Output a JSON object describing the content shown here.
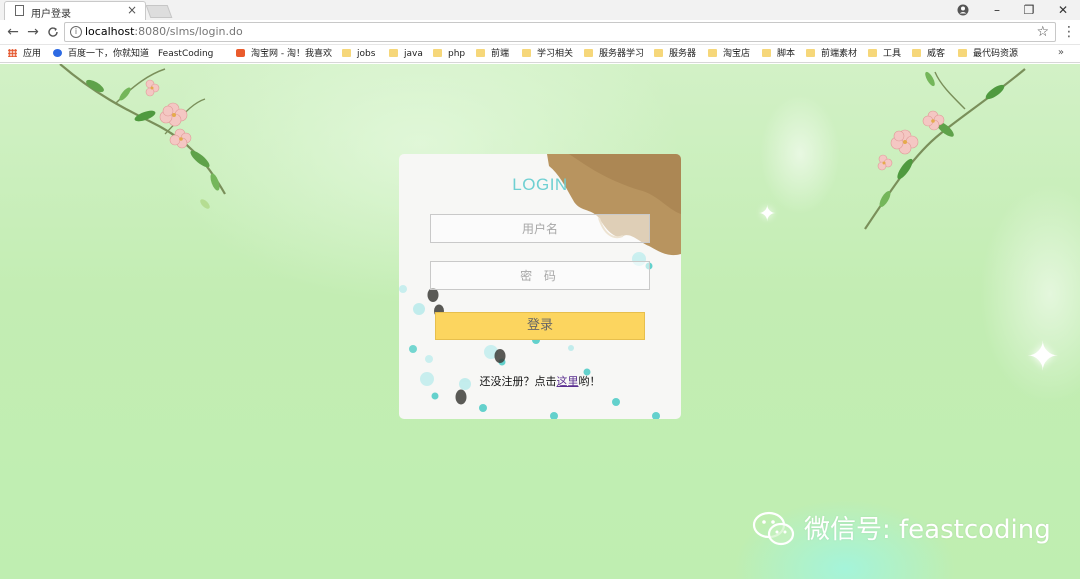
{
  "browser": {
    "tab_title": "用户登录",
    "tab_close": "×",
    "window_controls": {
      "minimize": "–",
      "maximize": "❐",
      "close": "✕"
    },
    "nav": {
      "back": "←",
      "forward": "→",
      "reload": "C"
    },
    "url_host": "localhost",
    "url_rest": ":8080/slms/login.do",
    "star": "☆",
    "menu": "⋮",
    "bookmarks": [
      {
        "label": "应用",
        "icon": "apps-icon"
      },
      {
        "label": "百度一下，你就知道",
        "icon": "baidu-icon"
      },
      {
        "label": "FeastCoding",
        "icon": "page-icon"
      },
      {
        "label": "淘宝网 - 淘！我喜欢",
        "icon": "taobao-icon"
      },
      {
        "label": "jobs",
        "icon": "folder-icon"
      },
      {
        "label": "java",
        "icon": "folder-icon"
      },
      {
        "label": "php",
        "icon": "folder-icon"
      },
      {
        "label": "前端",
        "icon": "folder-icon"
      },
      {
        "label": "学习相关",
        "icon": "folder-icon"
      },
      {
        "label": "服务器学习",
        "icon": "folder-icon"
      },
      {
        "label": "服务器",
        "icon": "folder-icon"
      },
      {
        "label": "淘宝店",
        "icon": "folder-icon"
      },
      {
        "label": "脚本",
        "icon": "folder-icon"
      },
      {
        "label": "前端素材",
        "icon": "folder-icon"
      },
      {
        "label": "工具",
        "icon": "folder-icon"
      },
      {
        "label": "威客",
        "icon": "folder-icon"
      },
      {
        "label": "最代码资源",
        "icon": "folder-icon"
      }
    ],
    "bookmarks_more": "»"
  },
  "login": {
    "title": "LOGIN",
    "username_placeholder": "用户名",
    "password_placeholder": "密 码",
    "submit_label": "登录",
    "register_prefix": "还没注册？点击",
    "register_link": "这里",
    "register_suffix": "哟！"
  },
  "watermark": {
    "text": "微信号: feastcoding"
  },
  "colors": {
    "accent_title": "#6fd0d2",
    "button": "#fcd55f",
    "background": "#c8f0bb"
  }
}
